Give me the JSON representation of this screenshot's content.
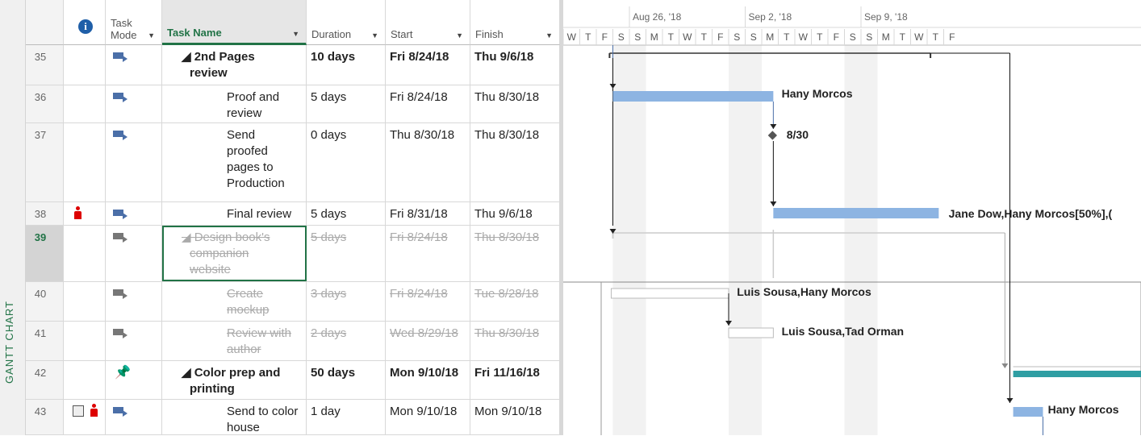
{
  "view_label": "GANTT CHART",
  "columns": {
    "info_icon": "info-icon",
    "task_mode": "Task\nMode",
    "task_name": "Task Name",
    "duration": "Duration",
    "start": "Start",
    "finish": "Finish"
  },
  "timeline": {
    "weeks": [
      "Aug 26, '18",
      "Sep 2, '18",
      "Sep 9, '18"
    ],
    "days": [
      "W",
      "T",
      "F",
      "S",
      "S",
      "M",
      "T",
      "W",
      "T",
      "F",
      "S",
      "S",
      "M",
      "T",
      "W",
      "T",
      "F",
      "S",
      "S",
      "M",
      "T",
      "W",
      "T",
      "F"
    ]
  },
  "tasks": [
    {
      "id": "35",
      "name": "◢ 2nd Pages review",
      "name_lines": [
        "◢ 2nd Pages",
        "review"
      ],
      "duration": "10 days",
      "start": "Fri 8/24/18",
      "finish": "Thu 9/6/18",
      "summary": true,
      "inactive": false,
      "mode": "auto",
      "indicators": []
    },
    {
      "id": "36",
      "name_lines": [
        "Proof and",
        "review"
      ],
      "duration": "5 days",
      "start": "Fri 8/24/18",
      "finish": "Thu 8/30/18",
      "summary": false,
      "inactive": false,
      "mode": "auto",
      "indicators": [],
      "resource_label": "Hany Morcos"
    },
    {
      "id": "37",
      "name_lines": [
        "Send",
        "proofed",
        "pages to",
        "Production"
      ],
      "duration": "0 days",
      "start": "Thu 8/30/18",
      "finish": "Thu 8/30/18",
      "summary": false,
      "inactive": false,
      "mode": "auto",
      "indicators": [],
      "resource_label": "8/30"
    },
    {
      "id": "38",
      "name_lines": [
        "Final review"
      ],
      "duration": "5 days",
      "start": "Fri 8/31/18",
      "finish": "Thu 9/6/18",
      "summary": false,
      "inactive": false,
      "mode": "auto",
      "indicators": [
        "person-icon"
      ],
      "resource_label": "Jane Dow,Hany Morcos[50%],("
    },
    {
      "id": "39",
      "name_lines": [
        "◢ Design book's",
        "companion",
        "website"
      ],
      "duration": "5 days",
      "start": "Fri 8/24/18",
      "finish": "Thu 8/30/18",
      "summary": true,
      "inactive": true,
      "mode": "auto",
      "indicators": []
    },
    {
      "id": "40",
      "name_lines": [
        "Create",
        "mockup"
      ],
      "duration": "3 days",
      "start": "Fri 8/24/18",
      "finish": "Tue 8/28/18",
      "summary": false,
      "inactive": true,
      "mode": "auto",
      "indicators": [],
      "resource_label": "Luis Sousa,Hany Morcos"
    },
    {
      "id": "41",
      "name_lines": [
        "Review with",
        "author"
      ],
      "duration": "2 days",
      "start": "Wed 8/29/18",
      "finish": "Thu 8/30/18",
      "summary": false,
      "inactive": true,
      "mode": "auto",
      "indicators": [],
      "resource_label": "Luis Sousa,Tad Orman"
    },
    {
      "id": "42",
      "name_lines": [
        "◢ Color prep and",
        "printing"
      ],
      "duration": "50 days",
      "start": "Mon 9/10/18",
      "finish": "Fri 11/16/18",
      "summary": true,
      "inactive": false,
      "mode": "manual-pin",
      "indicators": []
    },
    {
      "id": "43",
      "name_lines": [
        "Send to color",
        "house"
      ],
      "duration": "1 day",
      "start": "Mon 9/10/18",
      "finish": "Mon 9/10/18",
      "summary": false,
      "inactive": false,
      "mode": "auto",
      "indicators": [
        "notes-icon",
        "person-icon"
      ],
      "resource_label": "Hany Morcos"
    }
  ],
  "colors": {
    "accent": "#217346",
    "task_bar": "#8db4e2",
    "summary_bar": "#2f9ea3",
    "inactive_bar": "#ffffff",
    "weekend": "#f2f2f2"
  }
}
